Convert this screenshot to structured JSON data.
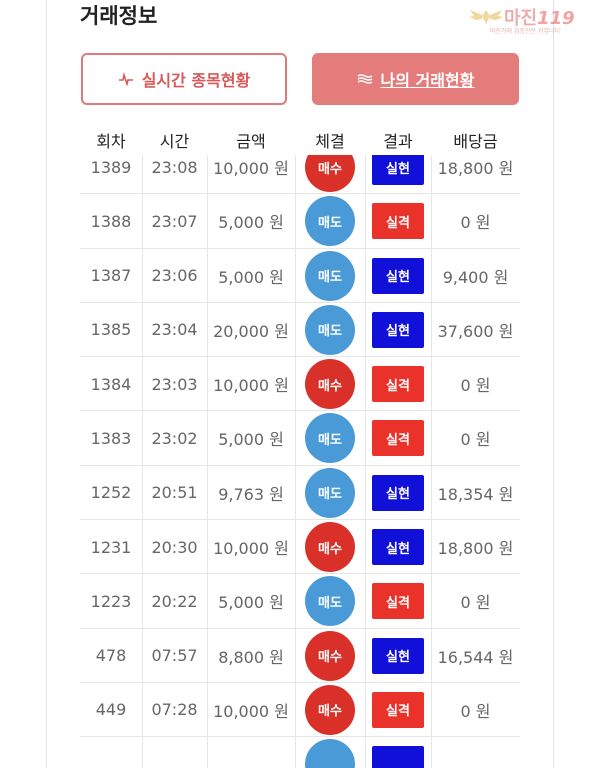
{
  "header": {
    "title": "거래정보",
    "watermark_text": "마진",
    "watermark_number": "119",
    "watermark_sub": "마진거래 검증전문 커뮤니티"
  },
  "buttons": {
    "realtime_label": "실시간 종목현황",
    "mine_label": "나의 거래현황"
  },
  "table": {
    "columns": [
      "회차",
      "시간",
      "금액",
      "체결",
      "결과",
      "배당금"
    ],
    "rows": [
      {
        "round": "1389",
        "time": "23:08",
        "amount": "10,000 원",
        "side": "매수",
        "side_type": "buy",
        "result": "실현",
        "result_type": "win",
        "payout": "18,800 원"
      },
      {
        "round": "1388",
        "time": "23:07",
        "amount": "5,000 원",
        "side": "매도",
        "side_type": "sell",
        "result": "실격",
        "result_type": "lose",
        "payout": "0 원"
      },
      {
        "round": "1387",
        "time": "23:06",
        "amount": "5,000 원",
        "side": "매도",
        "side_type": "sell",
        "result": "실현",
        "result_type": "win",
        "payout": "9,400 원"
      },
      {
        "round": "1385",
        "time": "23:04",
        "amount": "20,000 원",
        "side": "매도",
        "side_type": "sell",
        "result": "실현",
        "result_type": "win",
        "payout": "37,600 원"
      },
      {
        "round": "1384",
        "time": "23:03",
        "amount": "10,000 원",
        "side": "매수",
        "side_type": "buy",
        "result": "실격",
        "result_type": "lose",
        "payout": "0 원"
      },
      {
        "round": "1383",
        "time": "23:02",
        "amount": "5,000 원",
        "side": "매도",
        "side_type": "sell",
        "result": "실격",
        "result_type": "lose",
        "payout": "0 원"
      },
      {
        "round": "1252",
        "time": "20:51",
        "amount": "9,763 원",
        "side": "매도",
        "side_type": "sell",
        "result": "실현",
        "result_type": "win",
        "payout": "18,354 원"
      },
      {
        "round": "1231",
        "time": "20:30",
        "amount": "10,000 원",
        "side": "매수",
        "side_type": "buy",
        "result": "실현",
        "result_type": "win",
        "payout": "18,800 원"
      },
      {
        "round": "1223",
        "time": "20:22",
        "amount": "5,000 원",
        "side": "매도",
        "side_type": "sell",
        "result": "실격",
        "result_type": "lose",
        "payout": "0 원"
      },
      {
        "round": "478",
        "time": "07:57",
        "amount": "8,800 원",
        "side": "매수",
        "side_type": "buy",
        "result": "실현",
        "result_type": "win",
        "payout": "16,544 원"
      },
      {
        "round": "449",
        "time": "07:28",
        "amount": "10,000 원",
        "side": "매수",
        "side_type": "buy",
        "result": "실격",
        "result_type": "lose",
        "payout": "0 원"
      },
      {
        "round": "",
        "time": "",
        "amount": "",
        "side": "",
        "side_type": "sell",
        "result": "",
        "result_type": "win",
        "payout": ""
      }
    ]
  },
  "colors": {
    "buy": "#d9312a",
    "sell": "#4a9ad8",
    "win": "#1010d8",
    "lose": "#e8322a",
    "accent": "#e57c7c"
  }
}
